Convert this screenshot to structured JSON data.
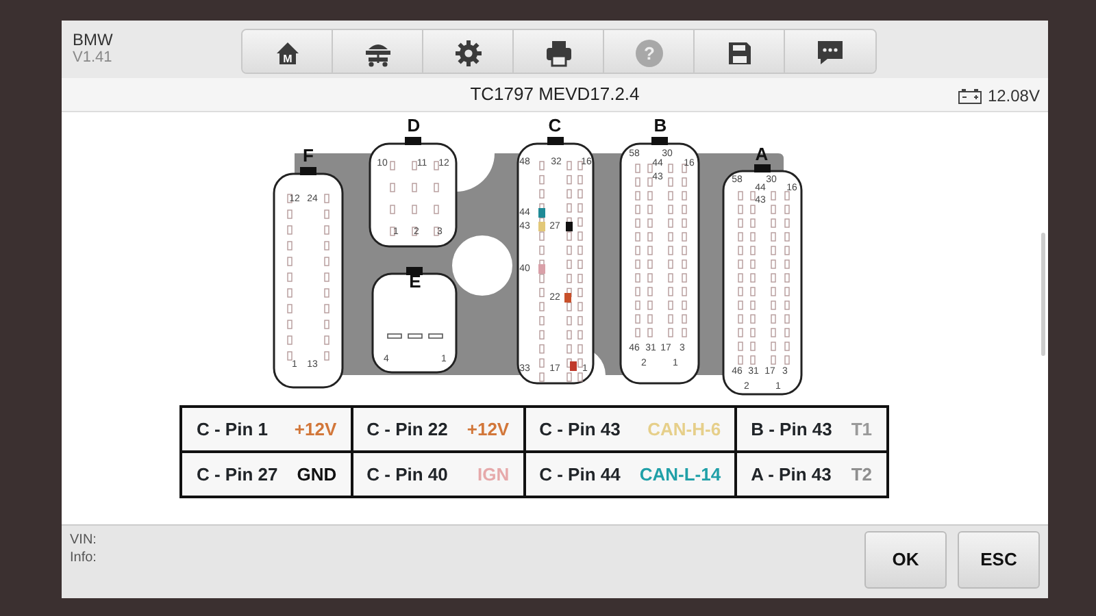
{
  "app": {
    "make": "BMW",
    "version": "V1.41"
  },
  "toolbar": [
    {
      "kind": "home",
      "label": "M",
      "disabled": false
    },
    {
      "kind": "lift",
      "disabled": false
    },
    {
      "kind": "settings",
      "disabled": false
    },
    {
      "kind": "print",
      "disabled": false
    },
    {
      "kind": "help",
      "label": "?",
      "disabled": true
    },
    {
      "kind": "save",
      "disabled": false
    },
    {
      "kind": "chat",
      "disabled": false
    }
  ],
  "status_bar": {
    "title": "TC1797 MEVD17.2.4",
    "voltage": "12.08V"
  },
  "connectors": [
    {
      "name": "F",
      "labels": [
        {
          "text": "12"
        },
        {
          "text": "24"
        },
        {
          "text": "1"
        },
        {
          "text": "13"
        }
      ]
    },
    {
      "name": "D",
      "labels": [
        {
          "text": "10"
        },
        {
          "text": "11"
        },
        {
          "text": "12"
        },
        {
          "text": "1"
        },
        {
          "text": "2"
        },
        {
          "text": "3"
        }
      ]
    },
    {
      "name": "E",
      "labels": [
        {
          "text": "4"
        },
        {
          "text": "1"
        }
      ]
    },
    {
      "name": "C",
      "labels": [
        {
          "text": "48"
        },
        {
          "text": "32"
        },
        {
          "text": "16"
        },
        {
          "text": "44",
          "color": "#1f8a96"
        },
        {
          "text": "43",
          "color": "#e2c878"
        },
        {
          "text": "27",
          "color": "#111111"
        },
        {
          "text": "40",
          "color": "#d9a0a8"
        },
        {
          "text": "22",
          "color": "#c8502a"
        },
        {
          "text": "33"
        },
        {
          "text": "17"
        },
        {
          "text": "1",
          "color": "#c0392b"
        }
      ]
    },
    {
      "name": "B",
      "labels": [
        {
          "text": "58"
        },
        {
          "text": "44"
        },
        {
          "text": "30"
        },
        {
          "text": "16"
        },
        {
          "text": "43"
        },
        {
          "text": "46"
        },
        {
          "text": "31"
        },
        {
          "text": "17"
        },
        {
          "text": "3"
        },
        {
          "text": "2"
        },
        {
          "text": "1"
        }
      ]
    },
    {
      "name": "A",
      "labels": [
        {
          "text": "58"
        },
        {
          "text": "44"
        },
        {
          "text": "30"
        },
        {
          "text": "16"
        },
        {
          "text": "43"
        },
        {
          "text": "46"
        },
        {
          "text": "31"
        },
        {
          "text": "17"
        },
        {
          "text": "3"
        },
        {
          "text": "2"
        },
        {
          "text": "1"
        }
      ]
    }
  ],
  "pin_table": {
    "rows": [
      [
        {
          "pin": "C - Pin 1",
          "signal": "+12V",
          "color": "#d2773a"
        },
        {
          "pin": "C - Pin 22",
          "signal": "+12V",
          "color": "#d2773a"
        },
        {
          "pin": "C - Pin 43",
          "signal": "CAN-H-6",
          "color": "#e6cf8a"
        },
        {
          "pin": "B - Pin 43",
          "signal": "T1",
          "color": "#9a9a9a"
        }
      ],
      [
        {
          "pin": "C - Pin 27",
          "signal": "GND",
          "color": "#111111"
        },
        {
          "pin": "C - Pin 40",
          "signal": "IGN",
          "color": "#e6a9aa"
        },
        {
          "pin": "C - Pin 44",
          "signal": "CAN-L-14",
          "color": "#20a0a8"
        },
        {
          "pin": "A - Pin 43",
          "signal": "T2",
          "color": "#8f8f8f"
        }
      ]
    ]
  },
  "footer": {
    "vin_label": "VIN:",
    "info_label": "Info:",
    "buttons": [
      "OK",
      "ESC"
    ]
  }
}
